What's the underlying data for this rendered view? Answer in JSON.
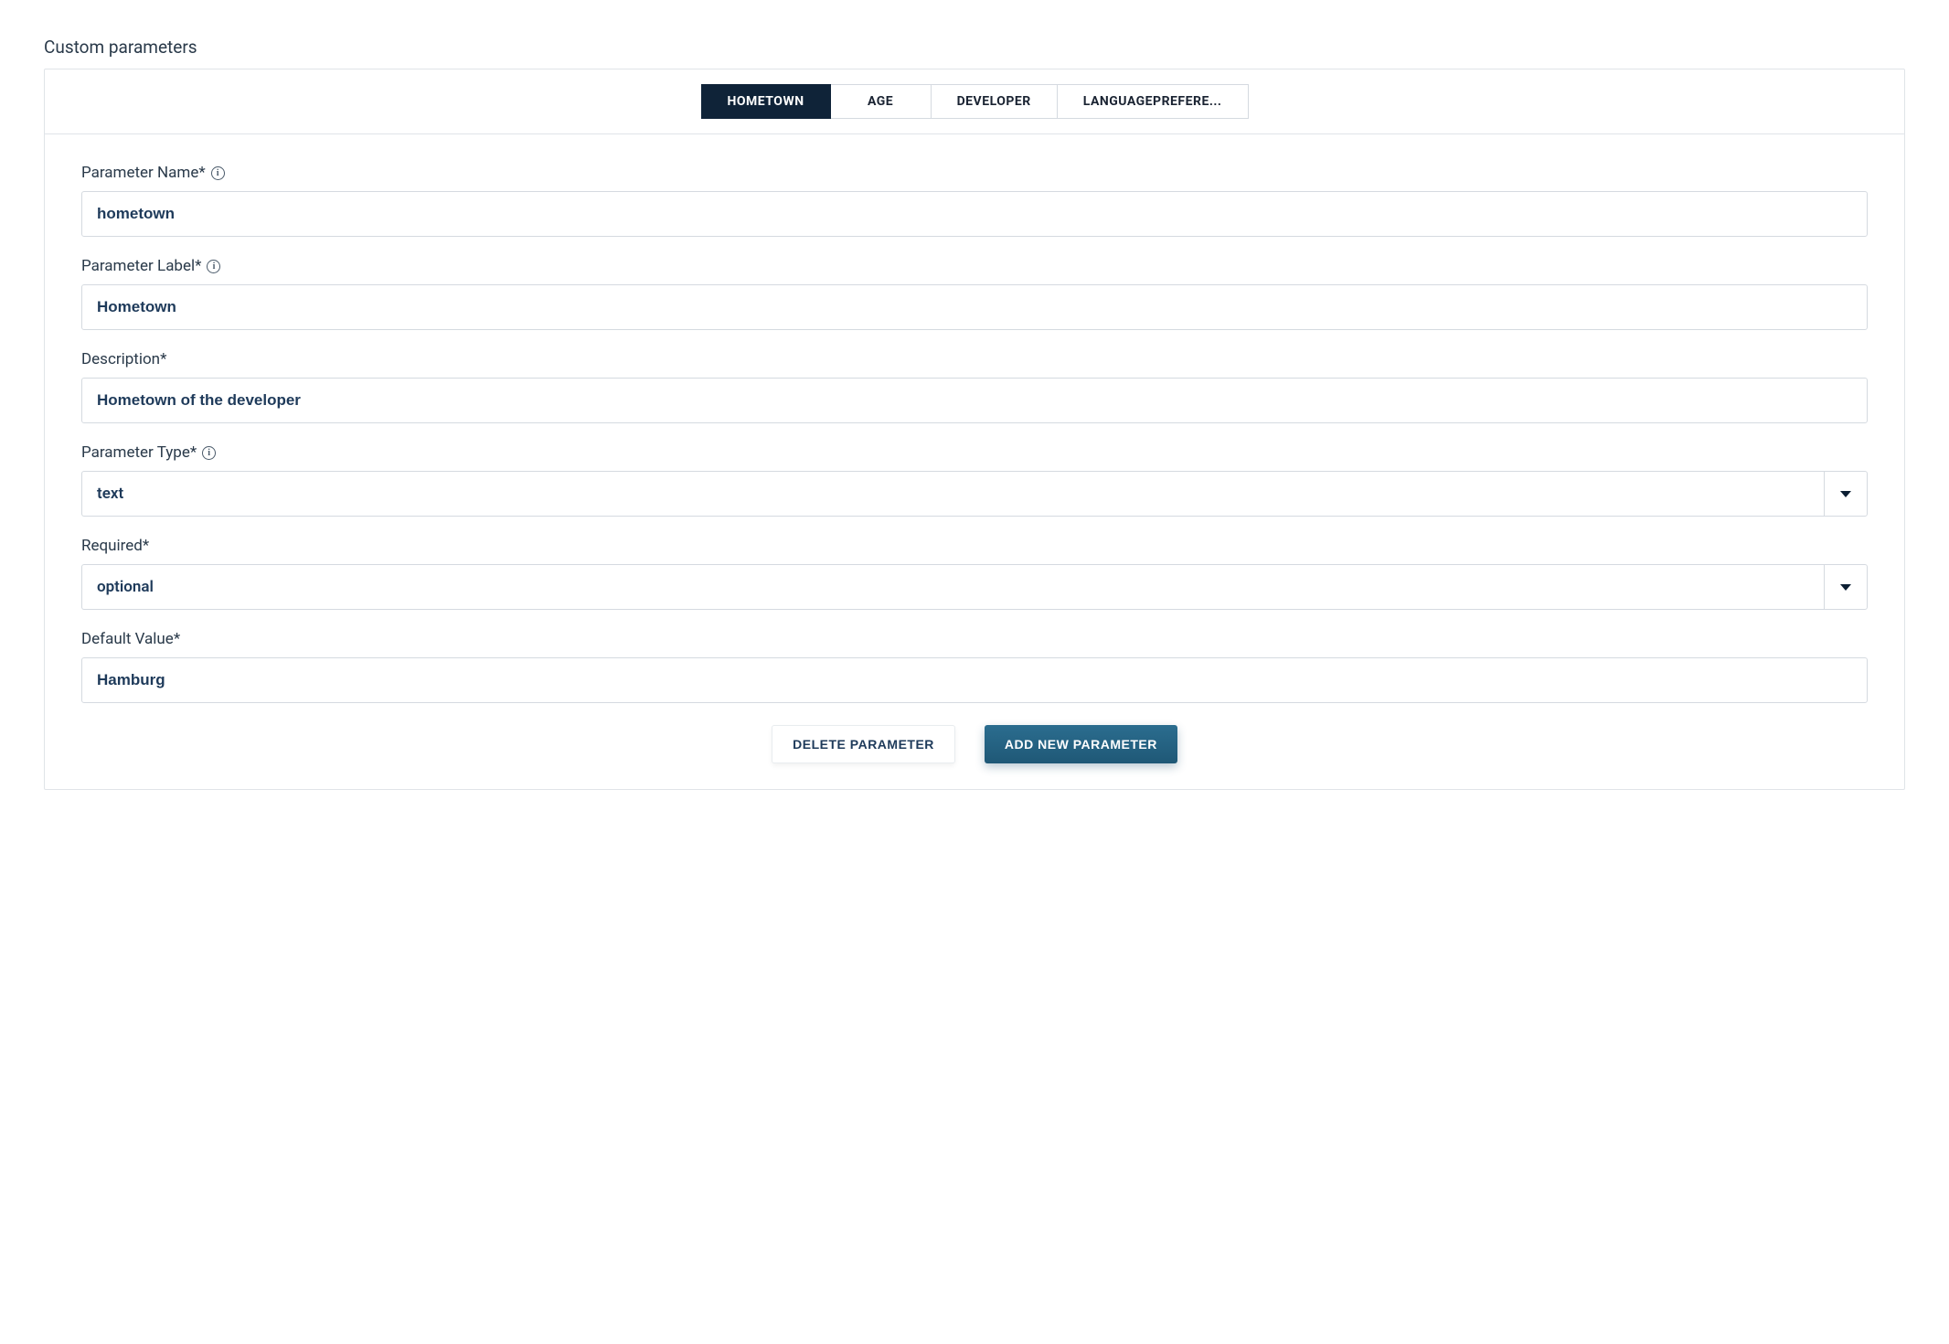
{
  "section_title": "Custom parameters",
  "tabs": [
    {
      "label": "HOMETOWN",
      "active": true
    },
    {
      "label": "AGE",
      "active": false
    },
    {
      "label": "DEVELOPER",
      "active": false
    },
    {
      "label": "LANGUAGEPREFERE...",
      "active": false
    }
  ],
  "fields": {
    "parameter_name": {
      "label": "Parameter Name*",
      "value": "hometown",
      "has_info": true
    },
    "parameter_label": {
      "label": "Parameter Label*",
      "value": "Hometown",
      "has_info": true
    },
    "description": {
      "label": "Description*",
      "value": "Hometown of the developer",
      "has_info": false
    },
    "parameter_type": {
      "label": "Parameter Type*",
      "value": "text",
      "has_info": true
    },
    "required": {
      "label": "Required*",
      "value": "optional",
      "has_info": false
    },
    "default_value": {
      "label": "Default Value*",
      "value": "Hamburg",
      "has_info": false
    }
  },
  "buttons": {
    "delete": "DELETE PARAMETER",
    "add": "ADD NEW PARAMETER"
  }
}
